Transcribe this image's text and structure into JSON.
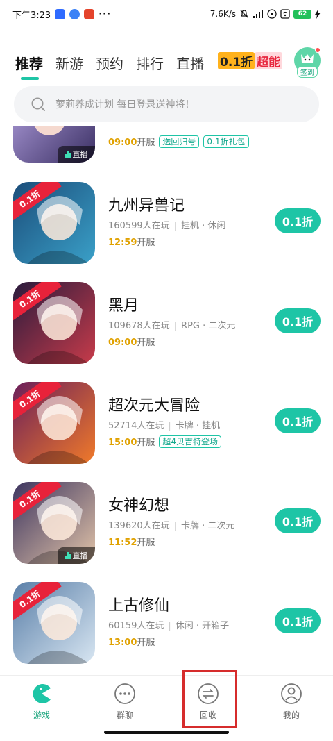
{
  "status_bar": {
    "time": "下午3:23",
    "dots": "···",
    "network_speed": "7.6K/s",
    "battery": "62"
  },
  "tabs": [
    {
      "label": "推荐",
      "active": true
    },
    {
      "label": "新游",
      "active": false
    },
    {
      "label": "预约",
      "active": false
    },
    {
      "label": "排行",
      "active": false
    },
    {
      "label": "直播",
      "active": false
    }
  ],
  "promo_tab": {
    "part1": "0.1折",
    "part2": "超能"
  },
  "signin": {
    "label": "签到"
  },
  "search": {
    "placeholder": "萝莉养成计划 每日登录送神将！"
  },
  "partial_game": {
    "time": "09:00",
    "open_label": "开服",
    "tags": [
      "送回归号",
      "0.1折礼包"
    ],
    "live_label": "直播"
  },
  "games": [
    {
      "name": "九州异兽记",
      "players": "160599人在玩",
      "genre": "挂机 · 休闲",
      "time": "12:59",
      "open_label": "开服",
      "tags": [],
      "ribbon": "0.1折",
      "button": "0.1折",
      "live": false,
      "colors": [
        "#1b4d7a",
        "#3aa0c8"
      ]
    },
    {
      "name": "黑月",
      "players": "109678人在玩",
      "genre": "RPG · 二次元",
      "time": "09:00",
      "open_label": "开服",
      "tags": [],
      "ribbon": "0.1折",
      "button": "0.1折",
      "live": false,
      "colors": [
        "#2a1b3d",
        "#c73b4a"
      ]
    },
    {
      "name": "超次元大冒险",
      "players": "52714人在玩",
      "genre": "卡牌 · 挂机",
      "time": "15:00",
      "open_label": "开服",
      "tags": [
        "超4贝吉特登场"
      ],
      "ribbon": "0.1折",
      "button": "0.1折",
      "live": false,
      "colors": [
        "#6b1f5a",
        "#f07a2a"
      ]
    },
    {
      "name": "女神幻想",
      "players": "139620人在玩",
      "genre": "卡牌 · 二次元",
      "time": "11:52",
      "open_label": "开服",
      "tags": [],
      "ribbon": "0.1折",
      "button": "0.1折",
      "live": true,
      "live_label": "直播",
      "colors": [
        "#3d3560",
        "#e2c4a8"
      ]
    },
    {
      "name": "上古修仙",
      "players": "60159人在玩",
      "genre": "休闲 · 开箱子",
      "time": "13:00",
      "open_label": "开服",
      "tags": [],
      "ribbon": "0.1折",
      "button": "0.1折",
      "live": false,
      "colors": [
        "#5a7fa8",
        "#d8e6f2"
      ]
    }
  ],
  "bottom_nav": [
    {
      "label": "游戏",
      "icon": "pacman-icon",
      "active": true
    },
    {
      "label": "群聊",
      "icon": "chat-bubble-icon",
      "active": false
    },
    {
      "label": "回收",
      "icon": "exchange-icon",
      "active": false
    },
    {
      "label": "我的",
      "icon": "user-icon",
      "active": false
    }
  ],
  "colors": {
    "accent": "#1ec5a6",
    "time": "#e0a100",
    "ribbon": "#e8223a",
    "highlight": "#d62c2c"
  }
}
